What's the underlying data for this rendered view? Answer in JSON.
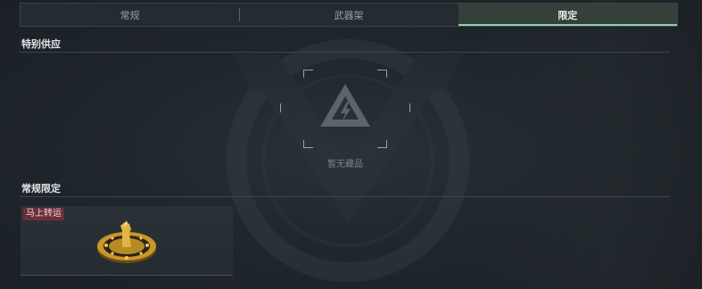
{
  "tabs": [
    {
      "label": "常规",
      "active": false
    },
    {
      "label": "武器架",
      "active": false
    },
    {
      "label": "限定",
      "active": true
    }
  ],
  "sections": {
    "special": {
      "title": "特别供应",
      "empty_text": "暂无藏品"
    },
    "regular_limited": {
      "title": "常规限定",
      "items": [
        {
          "tag": "马上转运",
          "icon": "golden-horse-medallion-icon"
        }
      ]
    }
  },
  "colors": {
    "active_tab_bg": "#33403c",
    "active_tab_underline": "#8fd2b0",
    "tag_bg": "#6a2f38"
  }
}
